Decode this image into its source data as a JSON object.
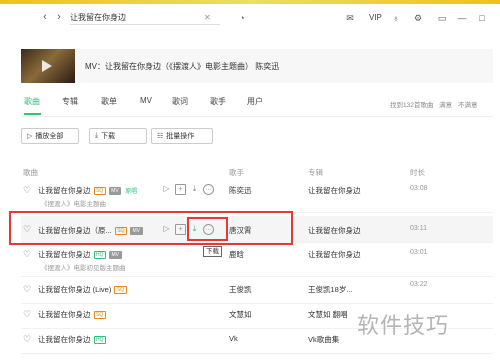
{
  "topbar": {
    "back": "‹",
    "forward": "›",
    "search_value": "让我留在你身边",
    "vip": "VIP"
  },
  "mv": {
    "title": "MV：让我留在你身边（《摆渡人》电影主题曲） 陈奕迅"
  },
  "tabs": [
    "歌曲",
    "专辑",
    "歌单",
    "MV",
    "歌词",
    "歌手",
    "用户"
  ],
  "result": {
    "count": "找到132首歌曲",
    "satisfied": "满意",
    "unsatisfied": "不满意"
  },
  "buttons": {
    "play_all": "播放全部",
    "download": "下载",
    "batch": "批量操作"
  },
  "columns": {
    "song": "歌曲",
    "singer": "歌手",
    "album": "专辑",
    "time": "时长"
  },
  "rows": [
    {
      "title": "让我留在你身边",
      "badges": [
        "SQ",
        "MV"
      ],
      "tag": "原唱",
      "sub": "《摆渡人》电影主题曲",
      "singer": "陈奕迅",
      "album": "让我留在你身边",
      "time": "03:08"
    },
    {
      "title": "让我留在你身边（原...",
      "badges": [
        "SQ",
        "MV"
      ],
      "tag": "",
      "sub": "",
      "singer": "唐汉霄",
      "album": "让我留在你身边",
      "time": "03:11"
    },
    {
      "title": "让我留在你身边",
      "badges": [
        "HQ",
        "MV"
      ],
      "tag": "",
      "sub": "《摆渡人》电影初见版主题曲",
      "singer": "鹿晗",
      "album": "让我留在你身边",
      "time": "03:01"
    },
    {
      "title": "让我留在你身边 (Live)",
      "badges": [
        "SQ"
      ],
      "tag": "",
      "sub": "",
      "singer": "王俊凯",
      "album": "王俊凯18岁...",
      "time": "03:22"
    },
    {
      "title": "让我留在你身边",
      "badges": [
        "SQ"
      ],
      "tag": "",
      "sub": "",
      "singer": "文慧如",
      "album": "文慧如 翻唱",
      "time": ""
    },
    {
      "title": "让我留在你身边",
      "badges": [
        "HQ"
      ],
      "tag": "",
      "sub": "",
      "singer": "Vk",
      "album": "Vk歌曲集",
      "time": ""
    }
  ],
  "tooltip": "下载",
  "watermark": "软件技巧"
}
